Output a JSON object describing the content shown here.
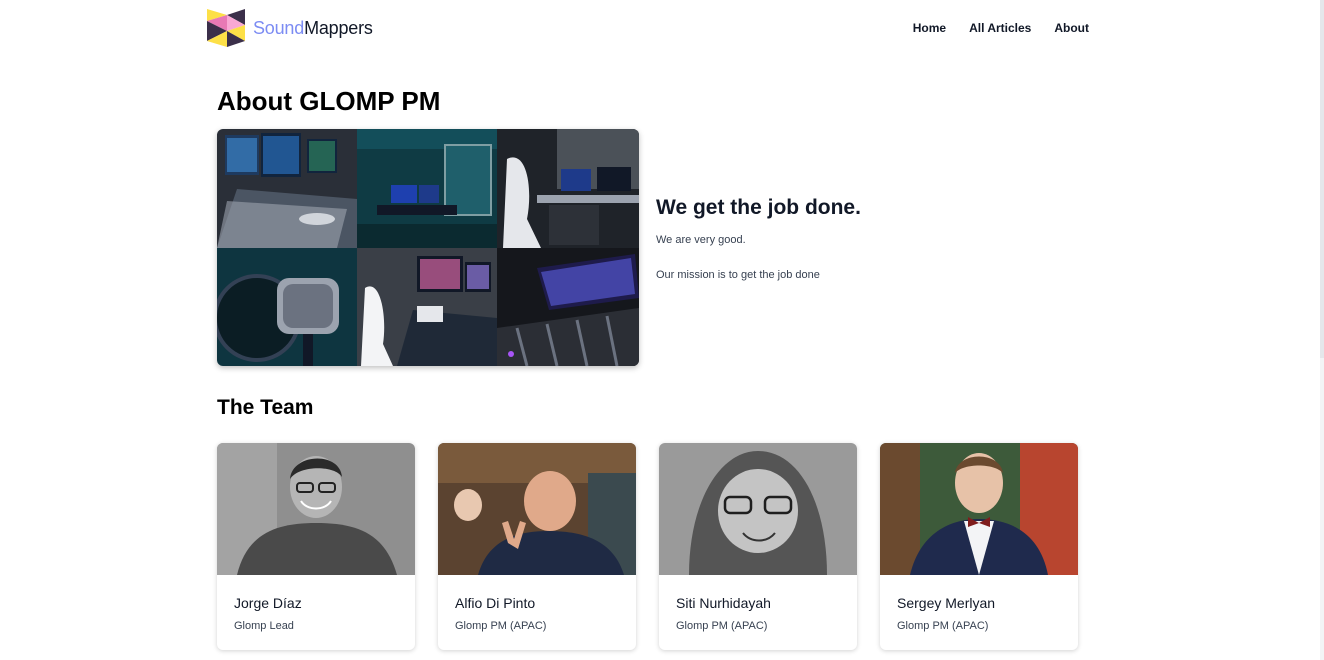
{
  "brand": {
    "name_part1": "Sound",
    "name_part2": "Mappers",
    "logo_icon": "soundmappers-logo-icon"
  },
  "nav": {
    "items": [
      "Home",
      "All Articles",
      "About"
    ]
  },
  "page": {
    "title": "About GLOMP PM",
    "tagline": "We get the job done.",
    "paragraph1": "We are very good.",
    "paragraph2": "Our mission is to get the job done"
  },
  "team": {
    "heading": "The Team",
    "members": [
      {
        "name": "Jorge Díaz",
        "role": "Glomp Lead"
      },
      {
        "name": "Alfio Di Pinto",
        "role": "Glomp PM (APAC)"
      },
      {
        "name": "Siti Nurhidayah",
        "role": "Glomp PM (APAC)"
      },
      {
        "name": "Sergey Merlyan",
        "role": "Glomp PM (APAC)"
      }
    ]
  },
  "colors": {
    "brand_accent": "#7c8cf3",
    "logo_yellow": "#fde047",
    "logo_pink": "#e879b5",
    "logo_dark": "#3b2f4a"
  }
}
